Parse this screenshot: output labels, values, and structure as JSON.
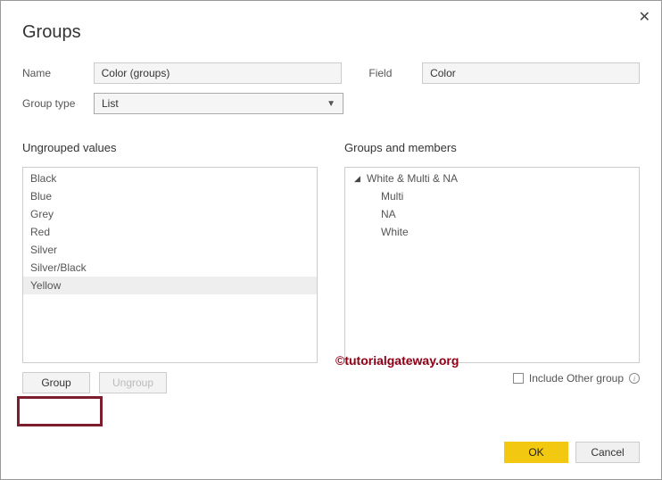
{
  "dialog": {
    "title": "Groups",
    "name_label": "Name",
    "name_value": "Color (groups)",
    "field_label": "Field",
    "field_value": "Color",
    "grouptype_label": "Group type",
    "grouptype_value": "List"
  },
  "left": {
    "header": "Ungrouped values",
    "items": [
      "Black",
      "Blue",
      "Grey",
      "Red",
      "Silver",
      "Silver/Black",
      "Yellow"
    ],
    "selected_index": 6,
    "group_btn": "Group",
    "ungroup_btn": "Ungroup"
  },
  "right": {
    "header": "Groups and members",
    "group_name": "White & Multi & NA",
    "members": [
      "Multi",
      "NA",
      "White"
    ],
    "include_other_label": "Include Other group"
  },
  "footer": {
    "ok": "OK",
    "cancel": "Cancel"
  },
  "watermark": "©tutorialgateway.org"
}
